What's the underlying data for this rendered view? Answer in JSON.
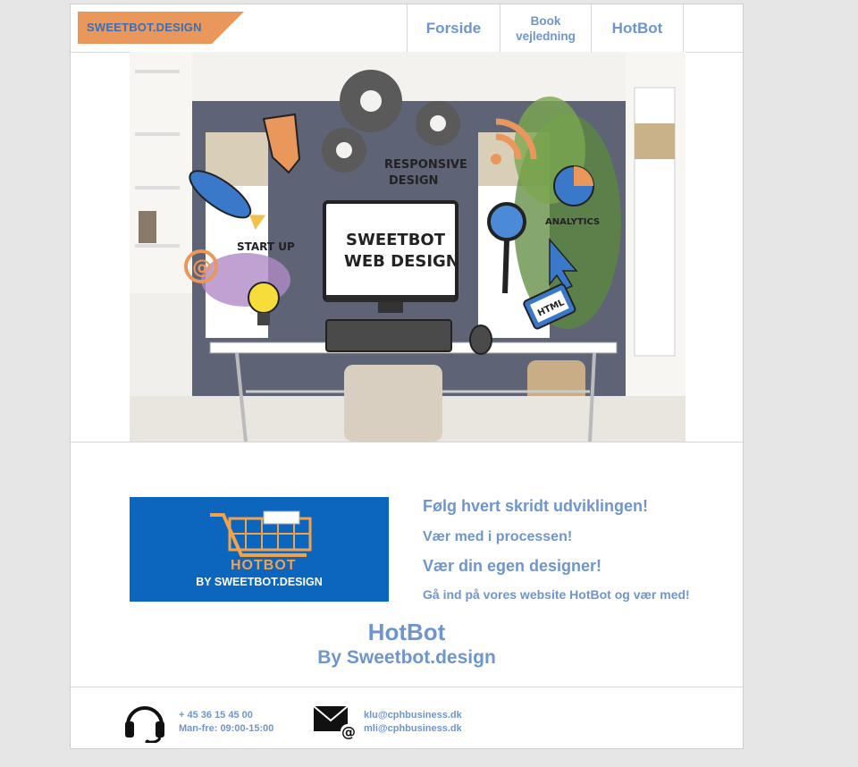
{
  "header": {
    "logo_text": "SWEETBOT.DESIGN",
    "nav": [
      {
        "label": "Forside"
      },
      {
        "label_line1": "Book",
        "label_line2": "vejledning"
      },
      {
        "label": "HotBot"
      }
    ]
  },
  "hero": {
    "screen_line1": "SWEETBOT",
    "screen_line2": "WEB DESIGN",
    "label_responsive_1": "RESPONSIVE",
    "label_responsive_2": "DESIGN",
    "label_startup": "START UP",
    "label_analytics": "ANALYTICS",
    "label_html": "HTML"
  },
  "promo": {
    "banner_title": "HOTBOT",
    "banner_subtitle": "BY SWEETBOT.DESIGN",
    "lines": [
      "Følg hvert skridt udviklingen!",
      "Vær med i processen!",
      "Vær din egen designer!",
      "Gå ind på vores website HotBot og vær med!"
    ],
    "title": "HotBot",
    "subtitle": "By Sweetbot.design"
  },
  "footer": {
    "phone": "+ 45 36 15 45 00",
    "hours": "Man-fre: 09:00-15:00",
    "email1": "klu@cphbusiness.dk",
    "email2": "mli@cphbusiness.dk"
  },
  "colors": {
    "accent_text": "#6f95cf",
    "logo_orange": "#e9975a",
    "logo_text": "#3b6fb5",
    "banner_blue": "#0d66bd",
    "banner_orange": "#f2a24a"
  },
  "icons": [
    "headset-icon",
    "email-icon",
    "shopping-cart-icon"
  ]
}
